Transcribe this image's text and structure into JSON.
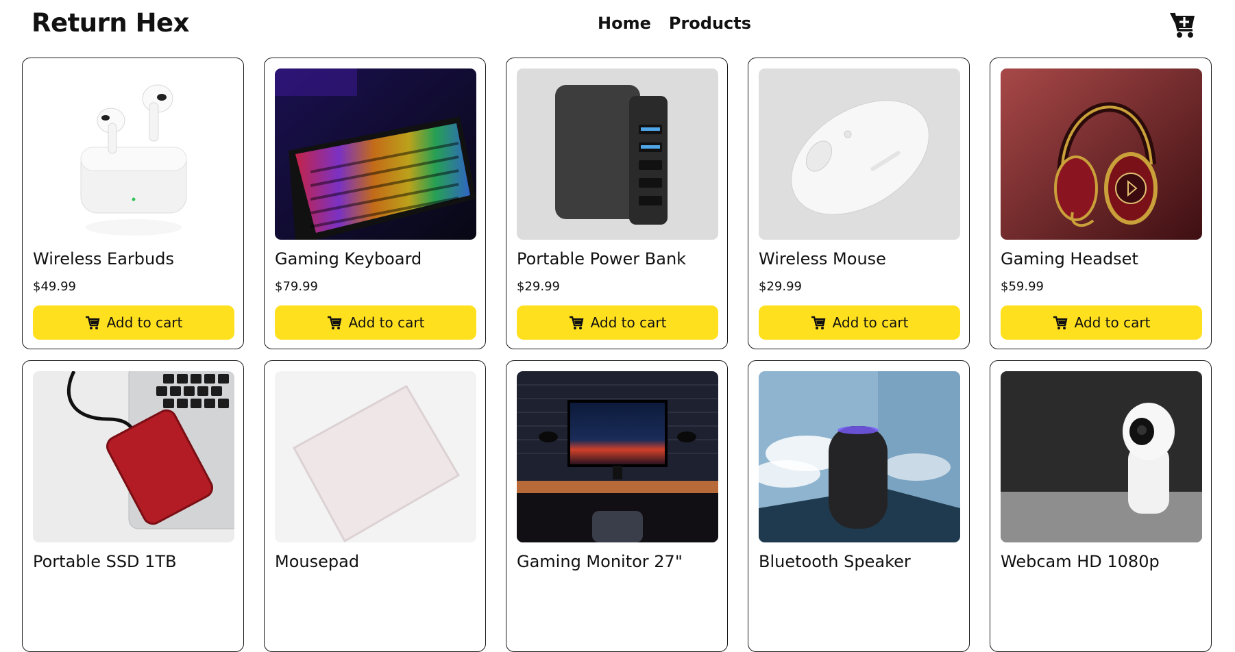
{
  "brand": "Return Hex",
  "nav": {
    "home": "Home",
    "products": "Products"
  },
  "icons": {
    "header_cart": "cart-plus-icon",
    "button_cart": "cart-icon"
  },
  "colors": {
    "button": "#ffe01f",
    "text": "#111111",
    "card_border": "#1a1a1a"
  },
  "add_to_cart_label": "Add to cart",
  "products": [
    {
      "name": "Wireless Earbuds",
      "price": "$49.99"
    },
    {
      "name": "Gaming Keyboard",
      "price": "$79.99"
    },
    {
      "name": "Portable Power Bank",
      "price": "$29.99"
    },
    {
      "name": "Wireless Mouse",
      "price": "$29.99"
    },
    {
      "name": "Gaming Headset",
      "price": "$59.99"
    },
    {
      "name": "Portable SSD 1TB",
      "price": ""
    },
    {
      "name": "Mousepad",
      "price": ""
    },
    {
      "name": "Gaming Monitor 27\"",
      "price": ""
    },
    {
      "name": "Bluetooth Speaker",
      "price": ""
    },
    {
      "name": "Webcam HD 1080p",
      "price": ""
    }
  ]
}
